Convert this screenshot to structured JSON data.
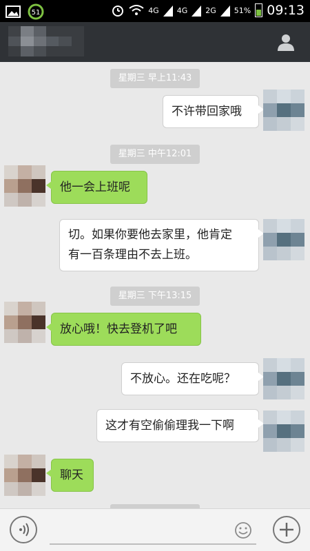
{
  "status_bar": {
    "notification_icons": [
      "image-icon",
      "sync-badge-icon"
    ],
    "badge_number": "51",
    "signal_icons": [
      "alarm-icon",
      "wifi-icon",
      "signal-4g-icon",
      "signal-2g-icon"
    ],
    "network_1": "4G",
    "network_2": "4G",
    "network_3": "2G",
    "battery_percent": "51%",
    "time": "09:13"
  },
  "header": {
    "contact_name_visible": false,
    "profile_icon": "person-icon"
  },
  "messages": [
    {
      "type": "timestamp",
      "text": "星期三 早上11:43"
    },
    {
      "type": "message",
      "side": "right",
      "text": "不许带回家哦"
    },
    {
      "type": "timestamp",
      "text": "星期三 中午12:01"
    },
    {
      "type": "message",
      "side": "left",
      "text": "他一会上班呢"
    },
    {
      "type": "message",
      "side": "right",
      "text_line1": "切。如果你要他去家里，他肯定",
      "text_line2": "有一百条理由不去上班。"
    },
    {
      "type": "timestamp",
      "text": "星期三 下午13:15"
    },
    {
      "type": "message",
      "side": "left",
      "text": "放心哦！快去登机了吧"
    },
    {
      "type": "message",
      "side": "right",
      "text": "不放心。还在吃呢？"
    },
    {
      "type": "message",
      "side": "right",
      "text": "这才有空偷偷理我一下啊"
    },
    {
      "type": "message",
      "side": "left",
      "text": "聊天"
    }
  ],
  "input_bar": {
    "voice_icon": "voice-icon",
    "emoji_icon": "emoji-icon",
    "plus_icon": "plus-icon",
    "placeholder": ""
  },
  "colors": {
    "header_bg": "#2f3236",
    "left_bubble": "#9ddc5a",
    "right_bubble": "#ffffff",
    "chat_bg": "#e9e9e9"
  }
}
